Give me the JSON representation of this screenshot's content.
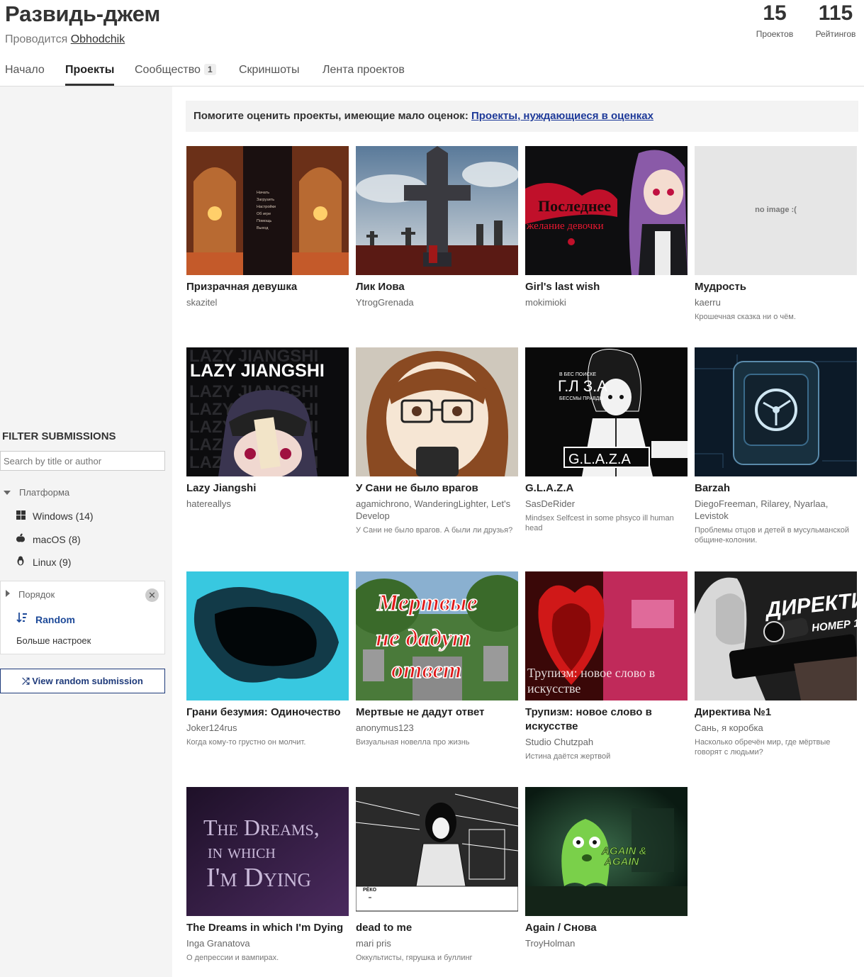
{
  "header": {
    "title": "Развидь-джем",
    "hosted_prefix": "Проводится",
    "host": "Obhodchik",
    "stats": [
      {
        "num": "15",
        "label": "Проектов"
      },
      {
        "num": "115",
        "label": "Рейтингов"
      }
    ]
  },
  "tabs": [
    {
      "label": "Начало"
    },
    {
      "label": "Проекты"
    },
    {
      "label": "Сообщество",
      "badge": "1"
    },
    {
      "label": "Скриншоты"
    },
    {
      "label": "Лента проектов"
    }
  ],
  "sidebar": {
    "filter_title": "FILTER SUBMISSIONS",
    "search_placeholder": "Search by title or author",
    "platform_title": "Платформа",
    "platforms": [
      {
        "label": "Windows (14)",
        "icon": "windows-icon"
      },
      {
        "label": "macOS (8)",
        "icon": "apple-icon"
      },
      {
        "label": "Linux (9)",
        "icon": "linux-icon"
      }
    ],
    "order_title": "Порядок",
    "order_value": "Random",
    "more_settings": "Больше настроек",
    "random_button": "View random submission"
  },
  "banner": {
    "text": "Помогите оценить проекты, имеющие мало оценок:",
    "link": "Проекты, нуждающиеся в оценках"
  },
  "no_image_text": "no image :(",
  "cards": [
    {
      "title": "Призрачная девушка",
      "author": "skazitel",
      "desc": ""
    },
    {
      "title": "Лик Иова",
      "author": "YtrogGrenada",
      "desc": ""
    },
    {
      "title": "Girl's last wish",
      "author": "mokimioki",
      "desc": ""
    },
    {
      "title": "Мудрость",
      "author": "kaerru",
      "desc": "Крошечная сказка ни о чём."
    },
    {
      "title": "Lazy Jiangshi",
      "author": "hatereallys",
      "desc": ""
    },
    {
      "title": "У Сани не было врагов",
      "author": "agamichrono, WanderingLighter, Let's Develop",
      "desc": "У Сани не было врагов. А были ли друзья?"
    },
    {
      "title": "G.L.A.Z.A",
      "author": "SasDeRider",
      "desc": "Mindsex Selfcest in some phsyco ill human head"
    },
    {
      "title": "Barzah",
      "author": "DiegoFreeman, Rilarey, Nyarlaa, Levistok",
      "desc": "Проблемы отцов и детей в мусульманской общине-колонии."
    },
    {
      "title": "Грани безумия: Одиночество",
      "author": "Joker124rus",
      "desc": "Когда кому-то грустно он молчит."
    },
    {
      "title": "Мертвые не дадут ответ",
      "author": "anonymus123",
      "desc": "Визуальная новелла про жизнь"
    },
    {
      "title": "Трупизм: новое слово в искусстве",
      "author": "Studio Chutzpah",
      "desc": "Истина даётся жертвой"
    },
    {
      "title": "Директива №1",
      "author": "Сань, я коробка",
      "desc": "Насколько обречён мир, где мёртвые говорят с людьми?"
    },
    {
      "title": "The Dreams in which I'm Dying",
      "author": "Inga Granatova",
      "desc": "О депрессии и вампирах."
    },
    {
      "title": "dead to me",
      "author": "mari pris",
      "desc": "Оккультисты, гярушка и буллинг"
    },
    {
      "title": "Again / Снова",
      "author": "TroyHolman",
      "desc": ""
    }
  ],
  "thumb_text": {
    "menu_items": [
      "Начать",
      "Загрузить",
      "Настройки",
      "Об игре",
      "Помощь",
      "Выход"
    ],
    "girls_line1": "Последнее",
    "girls_line2": "желание девочки",
    "lazy": "LAZY JIANGSHI",
    "glaza_top": "В БЕС    ПОИСКЕ",
    "glaza_big": "Г.Л  З.А",
    "glaza_sub": "БЕССМЫ      ПРАВДЫ",
    "glaza_bottom": "G.L.A.Z.A",
    "mertvye": [
      "Мертвые",
      "не дадут",
      "ответ"
    ],
    "trupizm": [
      "Трупизм: новое слово в",
      "искусстве"
    ],
    "direktiva": "ДИРЕКТИВА",
    "direktiva_sub": "НОМЕР 1",
    "dreams": [
      "The Dreams,",
      "in which",
      "I'm Dying"
    ],
    "dead_caption": "РЁКО",
    "again": [
      "AGAIN &",
      "AGAIN"
    ]
  },
  "colors": {
    "link": "#1e3a99",
    "accent": "#1e4a99",
    "sidebar_bg": "#f4f4f4"
  }
}
